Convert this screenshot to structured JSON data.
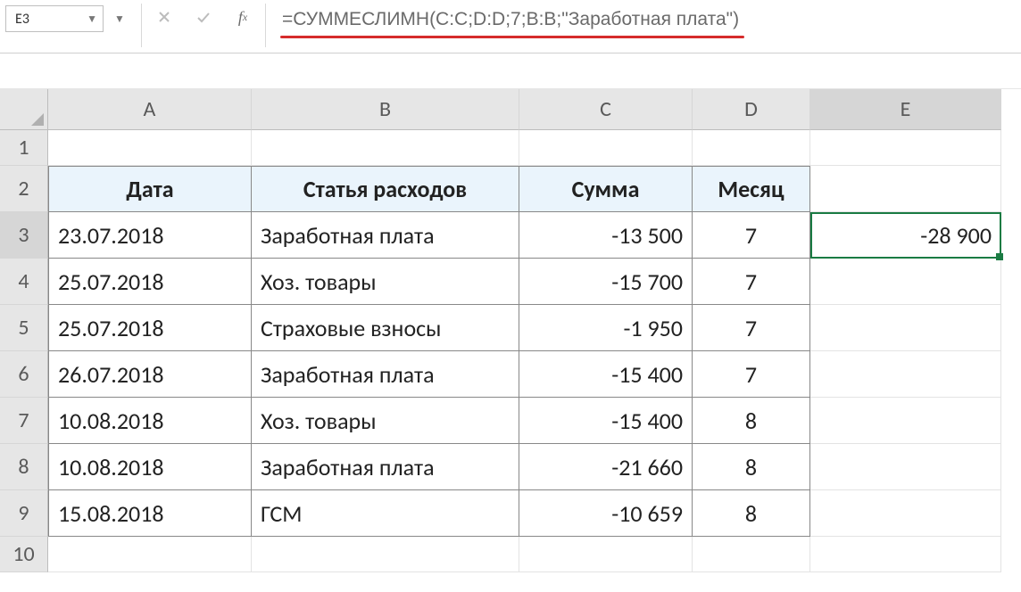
{
  "name_box": {
    "value": "E3"
  },
  "formula_bar": {
    "value": "=СУММЕСЛИМН(C:C;D:D;7;B:B;\"Заработная плата\")"
  },
  "columns": [
    "A",
    "B",
    "C",
    "D",
    "E"
  ],
  "rows": [
    "1",
    "2",
    "3",
    "4",
    "5",
    "6",
    "7",
    "8",
    "9",
    "10"
  ],
  "selected": {
    "col": "E",
    "row": "3"
  },
  "headers": {
    "A": "Дата",
    "B": "Статья расходов",
    "C": "Сумма",
    "D": "Месяц"
  },
  "table": [
    {
      "A": "23.07.2018",
      "B": "Заработная плата",
      "C": "-13 500",
      "D": "7"
    },
    {
      "A": "25.07.2018",
      "B": "Хоз. товары",
      "C": "-15 700",
      "D": "7"
    },
    {
      "A": "25.07.2018",
      "B": "Страховые взносы",
      "C": "-1 950",
      "D": "7"
    },
    {
      "A": "26.07.2018",
      "B": "Заработная плата",
      "C": "-15 400",
      "D": "7"
    },
    {
      "A": "10.08.2018",
      "B": "Хоз. товары",
      "C": "-15 400",
      "D": "8"
    },
    {
      "A": "10.08.2018",
      "B": "Заработная плата",
      "C": "-21 660",
      "D": "8"
    },
    {
      "A": "15.08.2018",
      "B": "ГСМ",
      "C": "-10 659",
      "D": "8"
    }
  ],
  "result_cell": {
    "value": "-28 900"
  },
  "icons": {
    "cancel": "cancel-icon",
    "enter": "enter-icon",
    "fx": "fx-icon"
  }
}
